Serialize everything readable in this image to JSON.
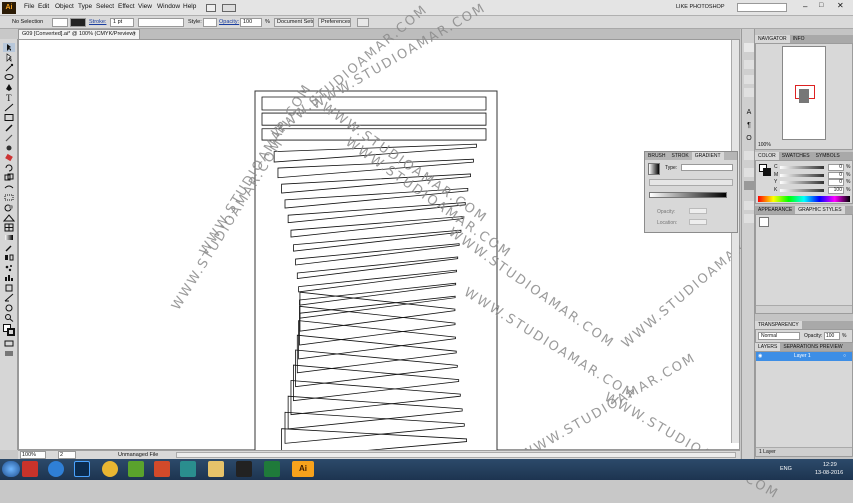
{
  "app": {
    "logo": "Ai",
    "workspace": "LIKE PHOTOSHOP"
  },
  "menu": [
    "File",
    "Edit",
    "Object",
    "Type",
    "Select",
    "Effect",
    "View",
    "Window",
    "Help"
  ],
  "control_bar": {
    "selection": "No Selection",
    "stroke_label": "Stroke:",
    "stroke_value": "1 pt",
    "style_label": "Style:",
    "opacity_label": "Opacity:",
    "opacity_value": "100",
    "percent": "%",
    "document_setup": "Document Setup",
    "preferences": "Preferences"
  },
  "document_tab": {
    "title": "G09 [Converted].ai* @ 100% (CMYK/Preview)",
    "close": "×"
  },
  "status": {
    "zoom": "100%",
    "artboard": "2",
    "file_state": "Unmanaged File"
  },
  "watermark": "WWW.STUDIOAMAR.COM",
  "navigator": {
    "tabs": [
      "NAVIGATOR",
      "INFO"
    ],
    "zoom": "100%"
  },
  "color_panel": {
    "tabs": [
      "COLOR",
      "SWATCHES",
      "SYMBOLS"
    ],
    "channels": [
      {
        "name": "C",
        "value": "0"
      },
      {
        "name": "M",
        "value": "0"
      },
      {
        "name": "Y",
        "value": "0"
      },
      {
        "name": "K",
        "value": "100"
      }
    ],
    "percent": "%"
  },
  "gradient_panel": {
    "tabs": [
      "BRUSH",
      "STROK",
      "GRADIENT"
    ],
    "type_label": "Type:",
    "opacity_label": "Opacity:",
    "location_label": "Location:",
    "percent": "%"
  },
  "appearance_panel": {
    "tabs": [
      "APPEARANCE",
      "GRAPHIC STYLES"
    ]
  },
  "transparency_panel": {
    "tab": "TRANSPARENCY",
    "mode": "Normal",
    "opacity_label": "Opacity:",
    "opacity_value": "100",
    "percent": "%"
  },
  "layers_panel": {
    "tabs": [
      "LAYERS",
      "SEPARATIONS PREVIEW"
    ],
    "layers": [
      "Layer 1"
    ],
    "count": "1 Layer"
  },
  "taskbar": {
    "language": "ENG",
    "time": "12:29",
    "date": "13-08-2016"
  },
  "colors": {
    "accent_selected": "#3d8ee6",
    "taskbar": "#1d3450",
    "ai_orange": "#f7a21c"
  }
}
